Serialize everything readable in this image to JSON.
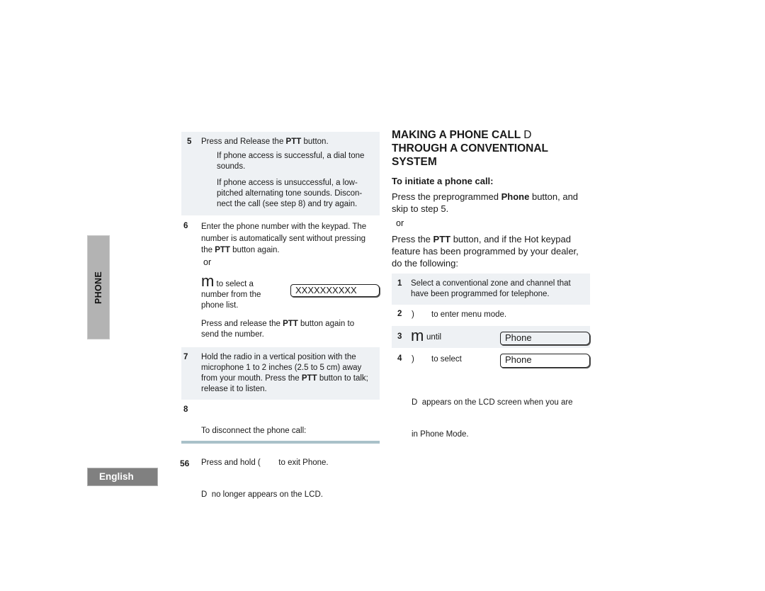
{
  "side_tab": {
    "label": "PHONE"
  },
  "language_tab": {
    "label": "English"
  },
  "page_number": "56",
  "left_column": {
    "step5": {
      "number": "5",
      "text_pre": "Press and Release the ",
      "text_bold": "PTT",
      "text_post": " button.",
      "result_success": "If phone access is successful, a dial tone sounds.",
      "result_fail_line1": "If phone access is unsuccessful, a low-",
      "result_fail_line2": "pitched alternating tone sounds. Discon-",
      "result_fail_line3": "nect the call (see step 8) and try again."
    },
    "step6": {
      "number": "6",
      "line1": "Enter the phone number with the keypad. The",
      "line2": "number is automatically sent without pressing",
      "line3_pre": "the ",
      "line3_bold": "PTT",
      "line3_post": " button again.",
      "or": "or",
      "m_glyph": "m",
      "select_line1": "to select a",
      "select_line2": "number from the",
      "select_line3": "phone list.",
      "lcd_display": "XXXXXXXXXX",
      "send_line1_pre": "Press and release the ",
      "send_line1_bold": "PTT",
      "send_line1_post": " button again to",
      "send_line2": "send the number."
    },
    "step7": {
      "number": "7",
      "line1": "Hold the radio in a vertical position with the",
      "line2": "microphone 1 to 2 inches (2.5 to 5 cm) away",
      "line3_pre": "from your mouth. Press the ",
      "line3_bold": "PTT",
      "line3_post": " button to talk;",
      "line4": "release it to listen."
    },
    "step8": {
      "number": "8",
      "line1": "To disconnect the phone call:",
      "line2": "Press and hold (        to exit Phone.",
      "line3": "D  no longer appears on the LCD."
    }
  },
  "right_column": {
    "heading_line1": "MAKING A PHONE CALL",
    "heading_glyph": "D",
    "heading_line2": "THROUGH A CONVENTIONAL",
    "heading_line3": "SYSTEM",
    "subheading": "To initiate a phone call:",
    "intro_line1_pre": "Press the preprogrammed ",
    "intro_line1_bold": "Phone",
    "intro_line1_post": " button, and",
    "intro_line2": "skip to step 5.",
    "or": "or",
    "ptt_line1_pre": "Press the ",
    "ptt_line1_bold": "PTT",
    "ptt_line1_post": " button, and if the Hot keypad",
    "ptt_line2": "feature has been programmed by your dealer,",
    "ptt_line3": "do the following:",
    "steps": [
      {
        "number": "1",
        "line1": "Select a conventional zone and channel that",
        "line2": "have been programmed for telephone."
      },
      {
        "number": "2",
        "glyph": ")",
        "text": "to enter menu mode."
      },
      {
        "number": "3",
        "glyph": "m",
        "text": "until",
        "lcd_display": "Phone"
      },
      {
        "number": "4",
        "glyph": ")",
        "text": "to select",
        "lcd_display": "Phone"
      }
    ],
    "note_line1": "D  appears on the LCD screen when you are",
    "note_line2": "in Phone Mode."
  }
}
